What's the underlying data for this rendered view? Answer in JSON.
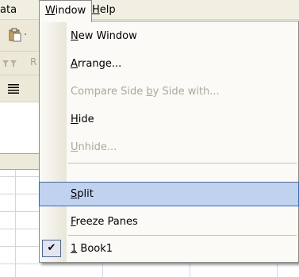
{
  "menubar": {
    "data_label": "ata",
    "window_prefix": "",
    "window_mnemonic": "W",
    "window_rest": "indow",
    "help_mnemonic": "H",
    "help_rest": "elp"
  },
  "background": {
    "toolbar_icons": [
      "paste-icon",
      "filter-icon",
      "align-left-icon"
    ],
    "toolbar_frag_1": "·",
    "toolbar_frag_2": "R"
  },
  "menu": {
    "items": [
      {
        "pre": "",
        "mn": "N",
        "post": "ew Window",
        "enabled": true
      },
      {
        "pre": "",
        "mn": "A",
        "post": "rrange...",
        "enabled": true
      },
      {
        "pre": "Compare Side ",
        "mn": "b",
        "post": "y Side with...",
        "enabled": false
      },
      {
        "pre": "",
        "mn": "H",
        "post": "ide",
        "enabled": true
      },
      {
        "pre": "",
        "mn": "U",
        "post": "nhide...",
        "enabled": false
      },
      {
        "pre": "",
        "mn": "S",
        "post": "plit",
        "enabled": true,
        "highlighted": true
      },
      {
        "pre": "",
        "mn": "F",
        "post": "reeze Panes",
        "enabled": true
      },
      {
        "pre": "",
        "mn": "1",
        "post": " Book1",
        "enabled": true,
        "checked": true
      }
    ],
    "check_glyph": "✔"
  }
}
